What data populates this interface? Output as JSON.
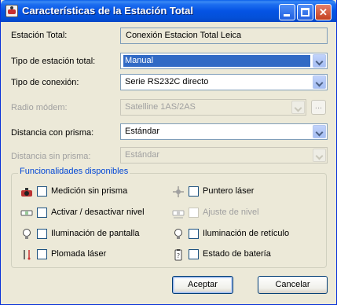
{
  "window": {
    "title": "Características de la Estación Total"
  },
  "fields": {
    "estacion_total": {
      "label": "Estación Total:",
      "value": "Conexión Estacion Total Leica"
    },
    "tipo_estacion": {
      "label": "Tipo de estación total:",
      "value": "Manual"
    },
    "tipo_conexion": {
      "label": "Tipo de conexión:",
      "value": "Serie RS232C directo"
    },
    "radio_modem": {
      "label": "Radio módem:",
      "value": "Satelline 1AS/2AS",
      "disabled": true,
      "browse_label": "..."
    },
    "distancia_con_prisma": {
      "label": "Distancia con prisma:",
      "value": "Estándar"
    },
    "distancia_sin_prisma": {
      "label": "Distancia sin prisma:",
      "value": "Estándar",
      "disabled": true
    }
  },
  "features": {
    "title": "Funcionalidades disponibles",
    "items": [
      {
        "label": "Medición sin prisma",
        "icon": "prism-icon",
        "checked": false,
        "disabled": false
      },
      {
        "label": "Puntero láser",
        "icon": "laser-pointer-icon",
        "checked": false,
        "disabled": false
      },
      {
        "label": "Activar / desactivar nivel",
        "icon": "level-icon",
        "checked": false,
        "disabled": false
      },
      {
        "label": "Ajuste de nivel",
        "icon": "level-adjust-icon",
        "checked": false,
        "disabled": true
      },
      {
        "label": "Iluminación de pantalla",
        "icon": "bulb-icon",
        "checked": false,
        "disabled": false
      },
      {
        "label": "Iluminación de retículo",
        "icon": "bulb-icon",
        "checked": false,
        "disabled": false
      },
      {
        "label": "Plomada láser",
        "icon": "plumb-laser-icon",
        "checked": false,
        "disabled": false
      },
      {
        "label": "Estado de batería",
        "icon": "battery-icon",
        "checked": false,
        "disabled": false
      }
    ]
  },
  "buttons": {
    "accept": "Aceptar",
    "cancel": "Cancelar"
  },
  "colors": {
    "titlebar": "#0553e4",
    "selection": "#316ac5",
    "group_title": "#0046d5",
    "disabled_text": "#a0a0a0",
    "window_bg": "#ece9d8"
  }
}
